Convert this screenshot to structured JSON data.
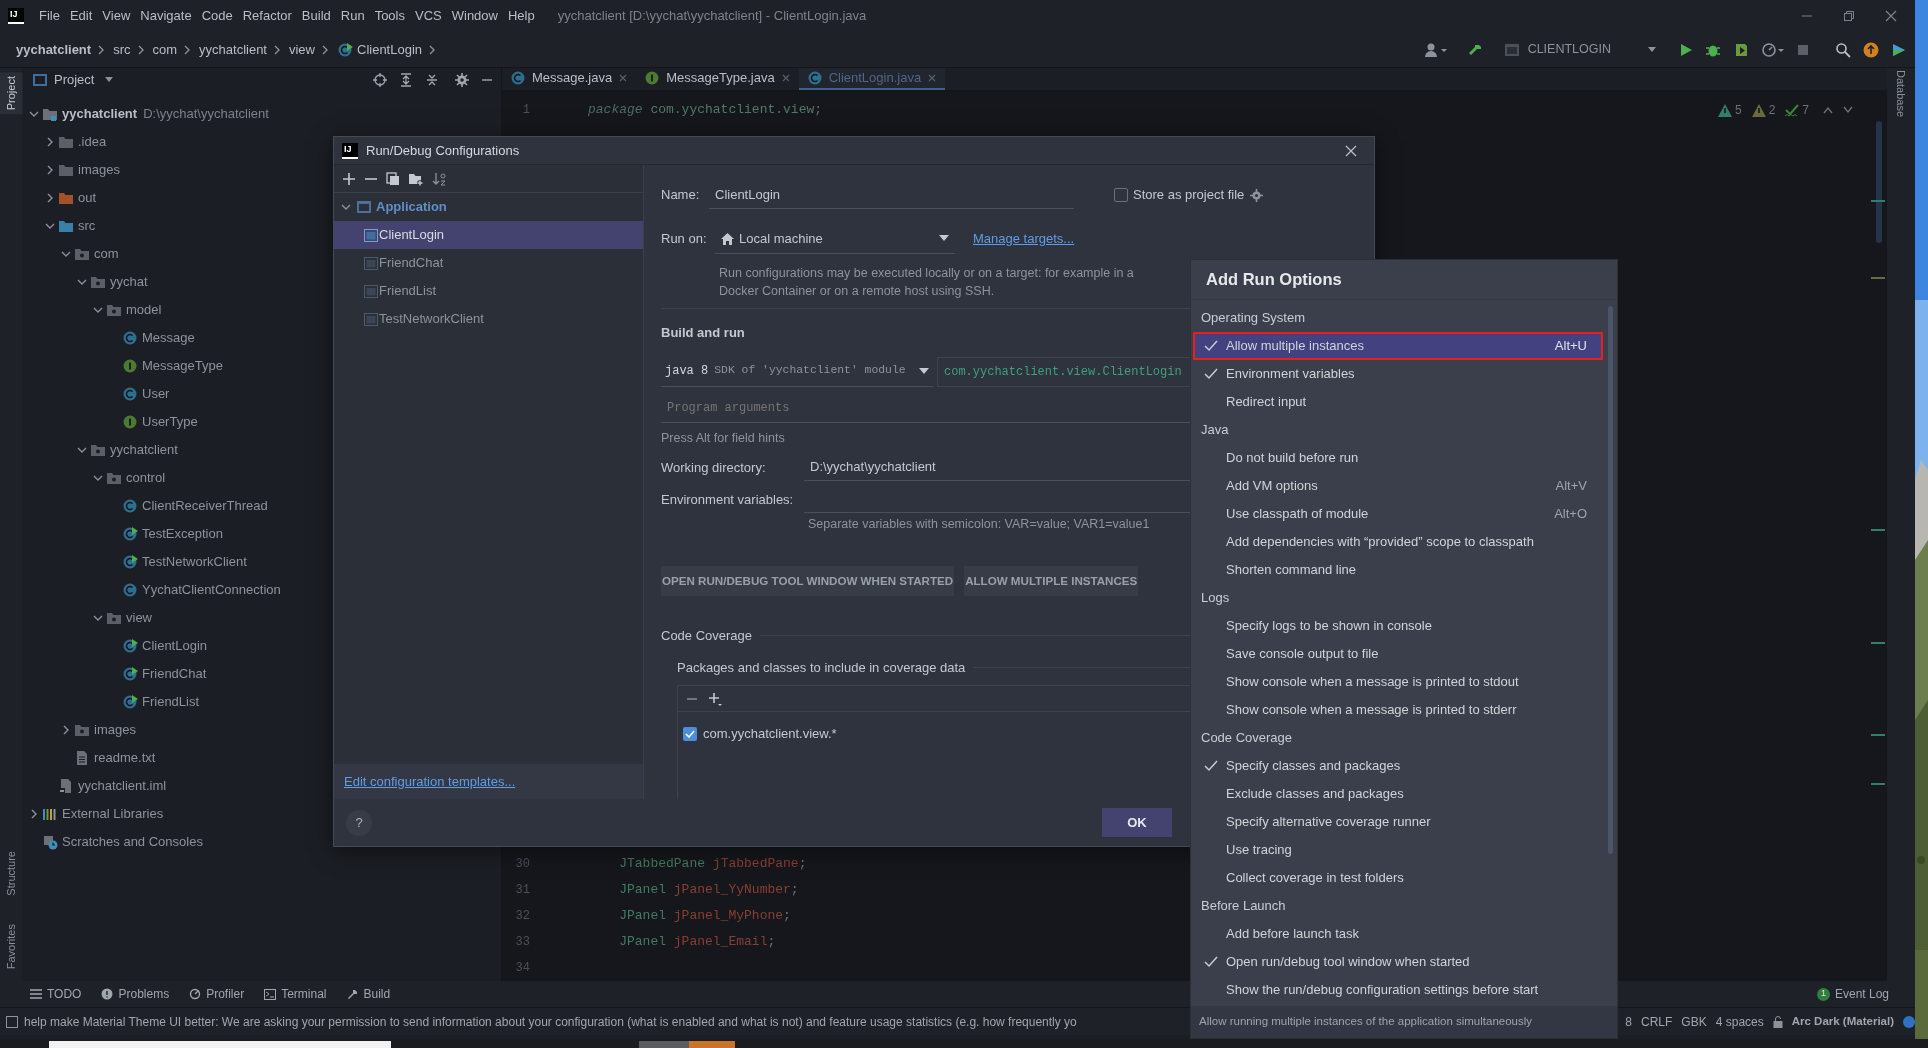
{
  "menu_bar": {
    "logo": "IJ",
    "items": [
      "File",
      "Edit",
      "View",
      "Navigate",
      "Code",
      "Refactor",
      "Build",
      "Run",
      "Tools",
      "VCS",
      "Window",
      "Help"
    ],
    "title": "yychatclient [D:\\yychat\\yychatclient] - ClientLogin.java"
  },
  "breadcrumbs": [
    {
      "label": "yychatclient",
      "kind": "project"
    },
    {
      "label": "src",
      "kind": "plain"
    },
    {
      "label": "com",
      "kind": "plain"
    },
    {
      "label": "yychatclient",
      "kind": "plain"
    },
    {
      "label": "view",
      "kind": "plain"
    },
    {
      "label": "ClientLogin",
      "kind": "class"
    }
  ],
  "run_config": "CLIENTLOGIN",
  "left_stripe": [
    {
      "label": "Project",
      "selected": true
    },
    {
      "label": "Structure",
      "selected": false
    },
    {
      "label": "Favorites",
      "selected": false
    }
  ],
  "right_stripe": [
    {
      "label": "Database",
      "selected": false
    }
  ],
  "project_panel": {
    "title": "Project",
    "tree": [
      {
        "label": "yychatclient",
        "path": "D:\\yychat\\yychatclient",
        "kind": "module",
        "expanded": true,
        "children": [
          {
            "label": ".idea",
            "kind": "folder",
            "expanded": false
          },
          {
            "label": "images",
            "kind": "folder",
            "expanded": false
          },
          {
            "label": "out",
            "kind": "excluded-folder",
            "expanded": false
          },
          {
            "label": "src",
            "kind": "source-folder",
            "expanded": true,
            "children": [
              {
                "label": "com",
                "kind": "package",
                "expanded": true,
                "children": [
                  {
                    "label": "yychat",
                    "kind": "package",
                    "expanded": true,
                    "children": [
                      {
                        "label": "model",
                        "kind": "package",
                        "expanded": true,
                        "children": [
                          {
                            "label": "Message",
                            "kind": "class"
                          },
                          {
                            "label": "MessageType",
                            "kind": "interface"
                          },
                          {
                            "label": "User",
                            "kind": "class"
                          },
                          {
                            "label": "UserType",
                            "kind": "interface"
                          }
                        ]
                      }
                    ]
                  },
                  {
                    "label": "yychatclient",
                    "kind": "package",
                    "expanded": true,
                    "children": [
                      {
                        "label": "control",
                        "kind": "package",
                        "expanded": true,
                        "children": [
                          {
                            "label": "ClientReceiverThread",
                            "kind": "class"
                          },
                          {
                            "label": "TestException",
                            "kind": "runnable-class"
                          },
                          {
                            "label": "TestNetworkClient",
                            "kind": "runnable-class"
                          },
                          {
                            "label": "YychatClientConnection",
                            "kind": "class"
                          }
                        ]
                      },
                      {
                        "label": "view",
                        "kind": "package",
                        "expanded": true,
                        "children": [
                          {
                            "label": "ClientLogin",
                            "kind": "runnable-class"
                          },
                          {
                            "label": "FriendChat",
                            "kind": "runnable-class"
                          },
                          {
                            "label": "FriendList",
                            "kind": "runnable-class"
                          }
                        ]
                      }
                    ]
                  }
                ]
              },
              {
                "label": "images",
                "kind": "package",
                "expanded": false
              },
              {
                "label": "readme.txt",
                "kind": "text-file"
              }
            ]
          },
          {
            "label": "yychatclient.iml",
            "kind": "iml-file"
          }
        ]
      },
      {
        "label": "External Libraries",
        "kind": "libraries",
        "expanded": false
      },
      {
        "label": "Scratches and Consoles",
        "kind": "scratches"
      }
    ]
  },
  "editor": {
    "tabs": [
      {
        "label": "Message.java",
        "kind": "class",
        "selected": false
      },
      {
        "label": "MessageType.java",
        "kind": "interface",
        "selected": false
      },
      {
        "label": "ClientLogin.java",
        "kind": "class",
        "selected": true
      }
    ],
    "inspections": [
      {
        "kind": "warning",
        "count": "5"
      },
      {
        "kind": "weak-warning",
        "count": "2"
      },
      {
        "kind": "typo",
        "count": "7"
      }
    ],
    "lines": [
      {
        "number": "1",
        "tokens": [
          {
            "kind": "keyword",
            "text": "package"
          },
          {
            "kind": "plain",
            "text": " com.yychatclient.view;"
          }
        ]
      },
      {
        "number": "30",
        "tokens": [
          {
            "kind": "type",
            "text": "    JTabbedPane"
          },
          {
            "kind": "field",
            "text": " jTabbedPane"
          },
          {
            "kind": "punct",
            "text": ";"
          }
        ]
      },
      {
        "number": "31",
        "tokens": [
          {
            "kind": "type",
            "text": "    JPanel"
          },
          {
            "kind": "field",
            "text": " jPanel_YyNumber"
          },
          {
            "kind": "punct",
            "text": ";"
          }
        ]
      },
      {
        "number": "32",
        "tokens": [
          {
            "kind": "type",
            "text": "    JPanel"
          },
          {
            "kind": "field",
            "text": " jPanel_MyPhone"
          },
          {
            "kind": "punct",
            "text": ";"
          }
        ]
      },
      {
        "number": "33",
        "tokens": [
          {
            "kind": "type",
            "text": "    JPanel"
          },
          {
            "kind": "field",
            "text": " jPanel_Email"
          },
          {
            "kind": "punct",
            "text": ";"
          }
        ]
      },
      {
        "number": "34"
      }
    ]
  },
  "dialog": {
    "logo": "IJ",
    "title": "Run/Debug Configurations",
    "tree": {
      "label": "Application",
      "expanded": true,
      "children": [
        {
          "label": "ClientLogin",
          "selected": true
        },
        {
          "label": "FriendChat",
          "selected": false
        },
        {
          "label": "FriendList",
          "selected": false
        },
        {
          "label": "TestNetworkClient",
          "selected": false
        }
      ]
    },
    "templates_link": "Edit configuration templates...",
    "name_label": "Name:",
    "name_value": "ClientLogin",
    "store_label": "Store as project file",
    "store_checked": false,
    "run_on_label": "Run on:",
    "run_on_value": "Local machine",
    "manage_link": "Manage targets...",
    "run_on_hint": "Run configurations may be executed locally or on a target: for example in a Docker Container or on a remote host using SSH.",
    "build_heading": "Build and run",
    "jre": "java 8",
    "jre_hint": "SDK of 'yychatclient' module",
    "main_class": "com.yychatclient.view.ClientLogin",
    "program_args_placeholder": "Program arguments",
    "field_hint": "Press Alt for field hints",
    "workdir_label": "Working directory:",
    "workdir_value": "D:\\yychat\\yychatclient",
    "env_label": "Environment variables:",
    "env_hint": "Separate variables with semicolon: VAR=value; VAR1=value1",
    "option_tags": [
      "OPEN RUN/DEBUG TOOL WINDOW WHEN STARTED",
      "ALLOW MULTIPLE INSTANCES"
    ],
    "coverage_heading": "Code Coverage",
    "coverage_sub": "Packages and classes to include in coverage data",
    "coverage_entries": [
      {
        "label": "com.yychatclient.view.*",
        "checked": true
      }
    ],
    "help": "?",
    "ok": "OK"
  },
  "popup": {
    "title": "Add Run Options",
    "sections": [
      {
        "heading": "Operating System",
        "items": [
          {
            "label": "Allow multiple instances",
            "checked": true,
            "selected": true,
            "outlined": true,
            "shortcut": "Alt+U"
          },
          {
            "label": "Environment variables",
            "checked": true,
            "selected": false,
            "outlined": false
          },
          {
            "label": "Redirect input",
            "checked": false,
            "selected": false,
            "outlined": false
          }
        ]
      },
      {
        "heading": "Java",
        "items": [
          {
            "label": "Do not build before run",
            "checked": false,
            "selected": false,
            "outlined": false
          },
          {
            "label": "Add VM options",
            "checked": false,
            "selected": false,
            "outlined": false,
            "shortcut": "Alt+V"
          },
          {
            "label": "Use classpath of module",
            "checked": false,
            "selected": false,
            "outlined": false,
            "shortcut": "Alt+O"
          },
          {
            "label": "Add dependencies with “provided” scope to classpath",
            "checked": false,
            "selected": false,
            "outlined": false
          },
          {
            "label": "Shorten command line",
            "checked": false,
            "selected": false,
            "outlined": false
          }
        ]
      },
      {
        "heading": "Logs",
        "items": [
          {
            "label": "Specify logs to be shown in console",
            "checked": false,
            "selected": false,
            "outlined": false
          },
          {
            "label": "Save console output to file",
            "checked": false,
            "selected": false,
            "outlined": false
          },
          {
            "label": "Show console when a message is printed to stdout",
            "checked": false,
            "selected": false,
            "outlined": false
          },
          {
            "label": "Show console when a message is printed to stderr",
            "checked": false,
            "selected": false,
            "outlined": false
          }
        ]
      },
      {
        "heading": "Code Coverage",
        "items": [
          {
            "label": "Specify classes and packages",
            "checked": true,
            "selected": false,
            "outlined": false
          },
          {
            "label": "Exclude classes and packages",
            "checked": false,
            "selected": false,
            "outlined": false
          },
          {
            "label": "Specify alternative coverage runner",
            "checked": false,
            "selected": false,
            "outlined": false
          },
          {
            "label": "Use tracing",
            "checked": false,
            "selected": false,
            "outlined": false
          },
          {
            "label": "Collect coverage in test folders",
            "checked": false,
            "selected": false,
            "outlined": false
          }
        ]
      },
      {
        "heading": "Before Launch",
        "items": [
          {
            "label": "Add before launch task",
            "checked": false,
            "selected": false,
            "outlined": false
          },
          {
            "label": "Open run/debug tool window when started",
            "checked": true,
            "selected": false,
            "outlined": false
          },
          {
            "label": "Show the run/debug configuration settings before start",
            "checked": false,
            "selected": false,
            "outlined": false
          }
        ]
      }
    ],
    "hint": "Allow running multiple instances of the application simultaneously"
  },
  "tool_windows": [
    {
      "label": "TODO",
      "kind": "todo"
    },
    {
      "label": "Problems",
      "kind": "problems"
    },
    {
      "label": "Profiler",
      "kind": "profiler"
    },
    {
      "label": "Terminal",
      "kind": "terminal"
    },
    {
      "label": "Build",
      "kind": "build"
    }
  ],
  "event_log": {
    "count": "1",
    "label": "Event Log"
  },
  "status_bar": {
    "message": "help make Material Theme UI better: We are asking your permission to send information about your configuration (what is enabled and what is not) and feature usage statistics (e.g. how frequently yo",
    "items": [
      "8",
      "CRLF",
      "GBK",
      "4 spaces"
    ],
    "theme": "Arc Dark (Material)"
  }
}
